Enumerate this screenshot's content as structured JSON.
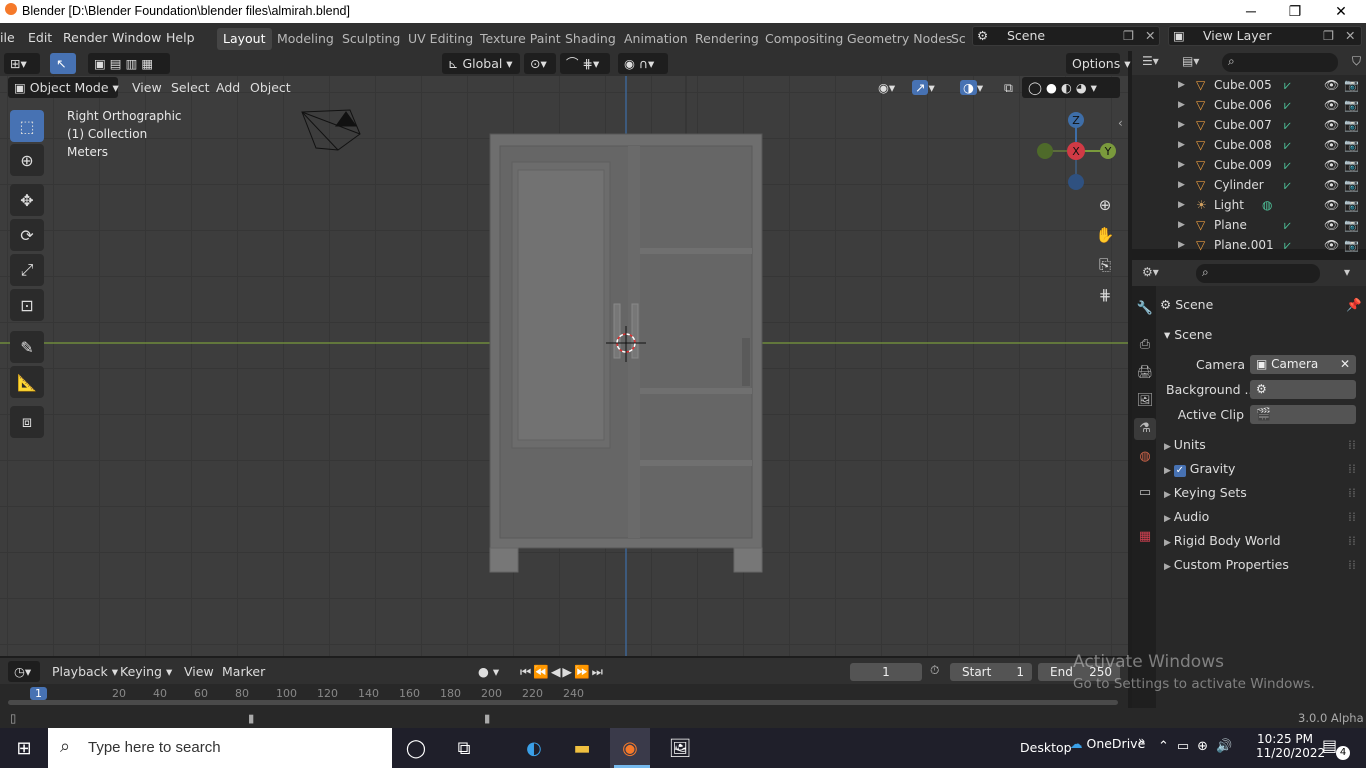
{
  "window": {
    "title": "Blender [D:\\Blender Foundation\\blender files\\almirah.blend]",
    "minimize": "─",
    "maximize": "❐",
    "close": "✕"
  },
  "menu": [
    "ile",
    "Edit",
    "Render",
    "Window",
    "Help"
  ],
  "workspaces": [
    "Layout",
    "Modeling",
    "Sculpting",
    "UV Editing",
    "Texture Paint",
    "Shading",
    "Animation",
    "Rendering",
    "Compositing",
    "Geometry Nodes",
    "Sc"
  ],
  "scene_selector": "Scene",
  "view_layer_selector": "View Layer",
  "viewport_header": {
    "mode": "Object Mode",
    "view": "View",
    "select": "Select",
    "add": "Add",
    "object": "Object",
    "transform": "Global",
    "options": "Options"
  },
  "overlay": {
    "line1": "Right Orthographic",
    "line2": "(1) Collection",
    "line3": "Meters"
  },
  "gizmo": {
    "z": "Z",
    "x": "X",
    "y": "Y"
  },
  "outliner": [
    {
      "name": "Cube.005",
      "icon": "mesh-data-icon"
    },
    {
      "name": "Cube.006",
      "icon": "mesh-data-icon"
    },
    {
      "name": "Cube.007",
      "icon": "mesh-data-icon"
    },
    {
      "name": "Cube.008",
      "icon": "mesh-data-icon"
    },
    {
      "name": "Cube.009",
      "icon": "mesh-data-icon"
    },
    {
      "name": "Cylinder",
      "icon": "mesh-data-icon"
    },
    {
      "name": "Light",
      "icon": "light-data-icon"
    },
    {
      "name": "Plane",
      "icon": "mesh-data-icon"
    },
    {
      "name": "Plane.001",
      "icon": "mesh-data-icon"
    }
  ],
  "properties": {
    "header": "Scene",
    "section": "Scene",
    "camera_label": "Camera",
    "camera_value": "Camera",
    "background_label": "Background ...",
    "active_clip_label": "Active Clip",
    "panels": [
      "Units",
      "Gravity",
      "Keying Sets",
      "Audio",
      "Rigid Body World",
      "Custom Properties"
    ]
  },
  "timeline": {
    "playback": "Playback",
    "keying": "Keying",
    "view": "View",
    "marker": "Marker",
    "current_frame": "1",
    "start_label": "Start",
    "start_value": "1",
    "end_label": "End",
    "end_value": "250",
    "ruler": [
      "1",
      "20",
      "40",
      "60",
      "80",
      "100",
      "120",
      "140",
      "160",
      "180",
      "200",
      "220",
      "240"
    ]
  },
  "status": {
    "version": "3.0.0 Alpha"
  },
  "activation": {
    "line1": "Activate Windows",
    "line2": "Go to Settings to activate Windows."
  },
  "taskbar": {
    "search_placeholder": "Type here to search",
    "desktop": "Desktop",
    "onedrive": "OneDrive",
    "time": "10:25 PM",
    "date": "11/20/2022",
    "notifications": "4"
  }
}
